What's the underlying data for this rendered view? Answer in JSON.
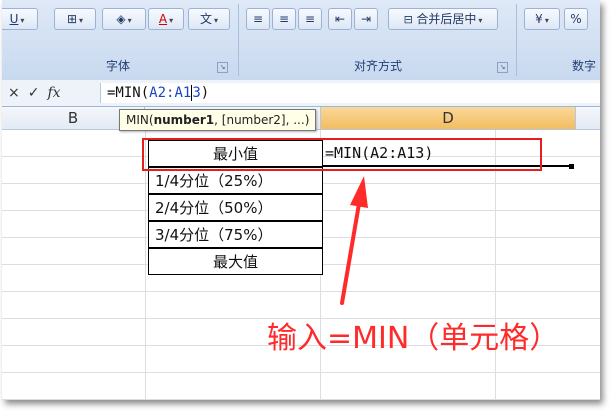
{
  "ribbon": {
    "font_group_label": "字体",
    "align_group_label": "对齐方式",
    "number_group_label": "数字",
    "merge_label": "合并后居中",
    "percent_label": "%"
  },
  "formula_bar": {
    "cancel_icon": "×",
    "enter_icon": "✓",
    "fx_icon": "fx",
    "prefix": "=MIN(",
    "ref_before_cursor": "A2:A1",
    "ref_after_cursor": "3",
    "suffix": ")"
  },
  "tooltip": {
    "fn": "MIN(",
    "arg1": "number1",
    "rest": ", [number2], ...)"
  },
  "columns": {
    "b": "B",
    "d": "D"
  },
  "cells": {
    "c1": "最小值",
    "c2": "1/4分位（25%）",
    "c3": "2/4分位（50%）",
    "c4": "3/4分位（75%）",
    "c5": "最大值",
    "d1": "=MIN(A2:A13)"
  },
  "annotation": "输入=MIN（单元格）",
  "colors": {
    "highlight": "#e61e1e",
    "ref": "#1a44c8",
    "selected_col": "#f3bd5e"
  }
}
